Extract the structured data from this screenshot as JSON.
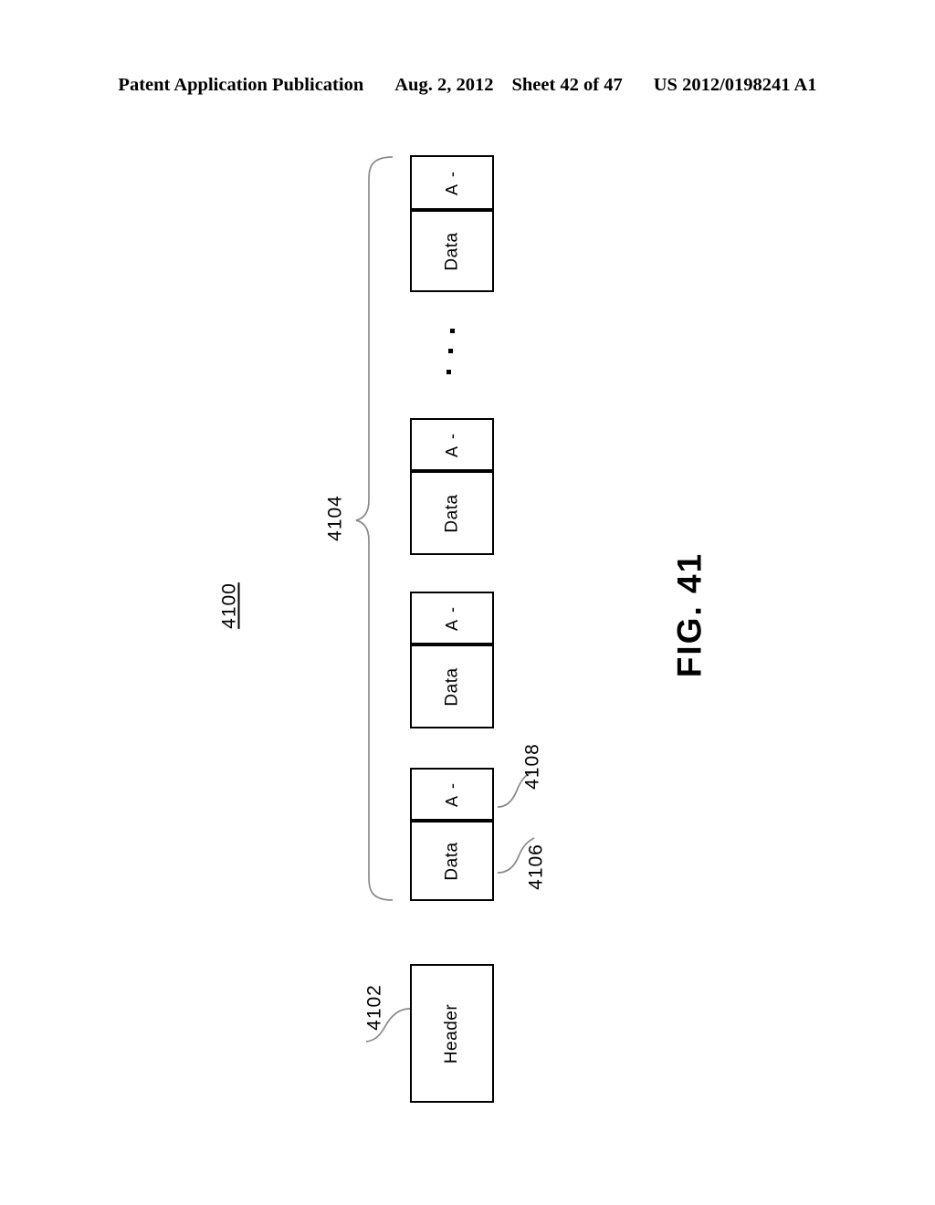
{
  "page_header": {
    "publication": "Patent Application Publication",
    "date": "Aug. 2, 2012",
    "sheet": "Sheet 42 of 47",
    "patent_number": "US 2012/0198241 A1"
  },
  "figure": {
    "caption": "FIG. 41",
    "diagram_number": "4100"
  },
  "labels": {
    "header_box": "Header",
    "data_cell": "Data",
    "subheader_cell": "A -",
    "subheader_letter": "A",
    "subheader_dash": "-"
  },
  "reference_numerals": {
    "header_ref": "4102",
    "group_ref": "4104",
    "data_ref": "4106",
    "subheader_ref": "4108"
  },
  "blocks": [
    {
      "id": "block-1",
      "subheader": "A -",
      "data": "Data"
    },
    {
      "id": "block-2",
      "subheader": "A -",
      "data": "Data"
    },
    {
      "id": "block-3",
      "subheader": "A -",
      "data": "Data"
    },
    {
      "id": "block-4",
      "subheader": "A -",
      "data": "Data"
    }
  ],
  "ellipsis": "▪ ▪ ▪",
  "colors": {
    "ink": "#000000",
    "background": "#ffffff",
    "leader_line": "#8a8a8a"
  }
}
